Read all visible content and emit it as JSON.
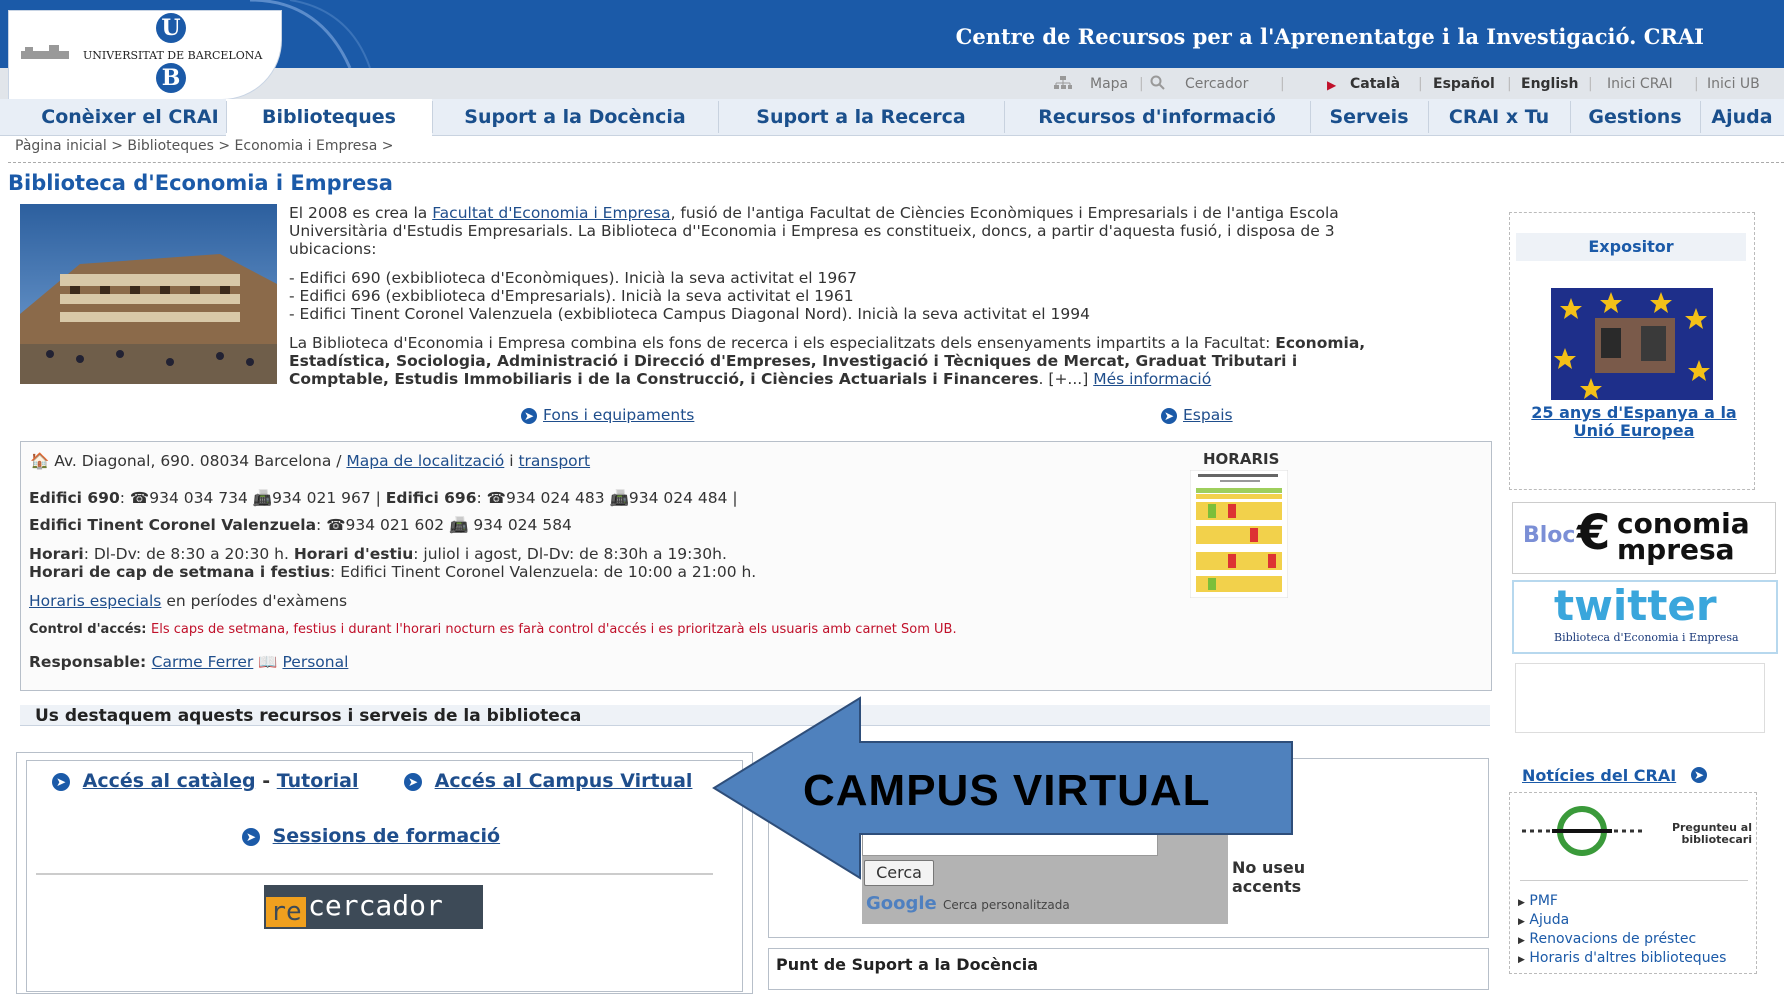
{
  "header": {
    "university": "UNIVERSITAT DE BARCELONA",
    "logo_letters": [
      "U",
      "B"
    ],
    "crai_title": "Centre de Recursos per a l'Aprenentatge i la Investigació. CRAI"
  },
  "toolbar": {
    "mapa": "Mapa",
    "cercador": "Cercador",
    "catala": "Català",
    "espanol": "Español",
    "english": "English",
    "inici_crai": "Inici CRAI",
    "inici_ub": "Inici UB"
  },
  "nav": {
    "items": [
      "Conèixer el CRAI",
      "Biblioteques",
      "Suport a la Docència",
      "Suport a la Recerca",
      "Recursos d'informació",
      "Serveis",
      "CRAI x Tu",
      "Gestions",
      "Ajuda"
    ],
    "active": "Biblioteques"
  },
  "breadcrumb": "Pàgina inicial > Biblioteques > Economia i Empresa >",
  "page_title": "Biblioteca d'Economia i Empresa",
  "intro": {
    "p1_start": "El 2008 es crea la ",
    "p1_link": "Facultat d'Economia i Empresa",
    "p1_end": ", fusió de l'antiga Facultat de Ciències Econòmiques i Empresarials i de l'antiga Escola",
    "p1_line2": "Universitària d'Estudis Empresarials. La Biblioteca d''Economia i Empresa es constitueix, doncs, a partir d'aquesta fusió, i disposa de 3",
    "p1_line3": "ubicacions:",
    "list": [
      "- Edifici 690 (exbiblioteca d'Econòmiques). Inicià la seva activitat el 1967",
      "- Edifici 696 (exbiblioteca d'Empresarials). Inicià la seva activitat el 1961",
      "- Edifici Tinent Coronel Valenzuela (exbiblioteca Campus Diagonal Nord). Inicià la seva activitat el 1994"
    ],
    "p2_start": "La Biblioteca d'Economia i Empresa combina els fons de recerca i els especialitzats dels ensenyaments impartits a la Facultat: ",
    "p2_bold1": "Economia,",
    "p2_bold2": "Estadística, Sociologia, Administració i Direcció d'Empreses, Investigació i Tècniques de Mercat, Graduat Tributari i",
    "p2_bold3": "Comptable, Estudis Immobiliaris i de la Construcció, i Ciències Actuarials i Financeres",
    "p2_more": ".  [+...] ",
    "p2_link": "Més informació"
  },
  "links": {
    "fons": "Fons i equipaments",
    "espais": "Espais"
  },
  "info": {
    "address": "Av. Diagonal, 690. 08034 Barcelona / ",
    "mapa": "Mapa de localització",
    "i": " i ",
    "transport": "transport",
    "ed690_label": "Edifici 690",
    "ed690_tel": "934 034 734",
    "ed690_fax": "934 021 967",
    "ed696_label": "Edifici 696",
    "ed696_tel": "934 024 483",
    "ed696_fax": "934 024 484",
    "tcv_label": "Edifici Tinent Coronel Valenzuela",
    "tcv_tel": "934 021 602",
    "tcv_fax": "934 024 584",
    "horari_label": "Horari",
    "horari": ": Dl-Dv: de 8:30 a 20:30 h. ",
    "estiu_label": "Horari d'estiu",
    "estiu": ": juliol i agost, Dl-Dv: de 8:30h a 19:30h.",
    "cap_label": "Horari de cap de setmana i festius",
    "cap": ": Edifici Tinent Coronel Valenzuela: de 10:00 a 21:00 h.",
    "especials_link": "Horaris especials",
    "especials": " en períodes d'exàmens",
    "control_label": "Control d'accés: ",
    "control": "Els caps de setmana, festius i durant l'horari nocturn es farà control d'accés i es prioritzarà els usuaris amb carnet Som UB.",
    "resp_label": "Responsable: ",
    "resp_name": "Carme Ferrer",
    "personal": "Personal",
    "horaris_title": "HORARIS"
  },
  "section_title": "Us destaquem aquests recursos i serveis de la biblioteca",
  "resources": {
    "cataleg": "Accés al catàleg",
    "dash": " - ",
    "tutorial": "Tutorial",
    "campus": "Accés al Campus Virtual",
    "sessions": "Sessions de formació",
    "recercador_re": "re",
    "recercador_rest": "cercador"
  },
  "search": {
    "button": "Cerca",
    "google": "Google",
    "personalitzada": "Cerca personalitzada",
    "no_accents": "No useu accents"
  },
  "punt": "Punt de Suport a la Docència",
  "overlay": {
    "label": "CAMPUS VIRTUAL",
    "color": "#4f81bd"
  },
  "sidebar": {
    "expositor": "Expositor",
    "expo_caption": "25 anys d'Espanya a la Unió Europea",
    "bloc": "Bloc",
    "bloc_word1": "conomia",
    "bloc_word2": "mpresa",
    "twitter": "twitter",
    "twitter_sub": "Biblioteca d'Economia i Empresa",
    "noticies": "Notícies del CRAI",
    "pregunteu": "Pregunteu al bibliotecari",
    "links": [
      "PMF",
      "Ajuda",
      "Renovacions de préstec",
      "Horaris d'altres biblioteques"
    ]
  }
}
